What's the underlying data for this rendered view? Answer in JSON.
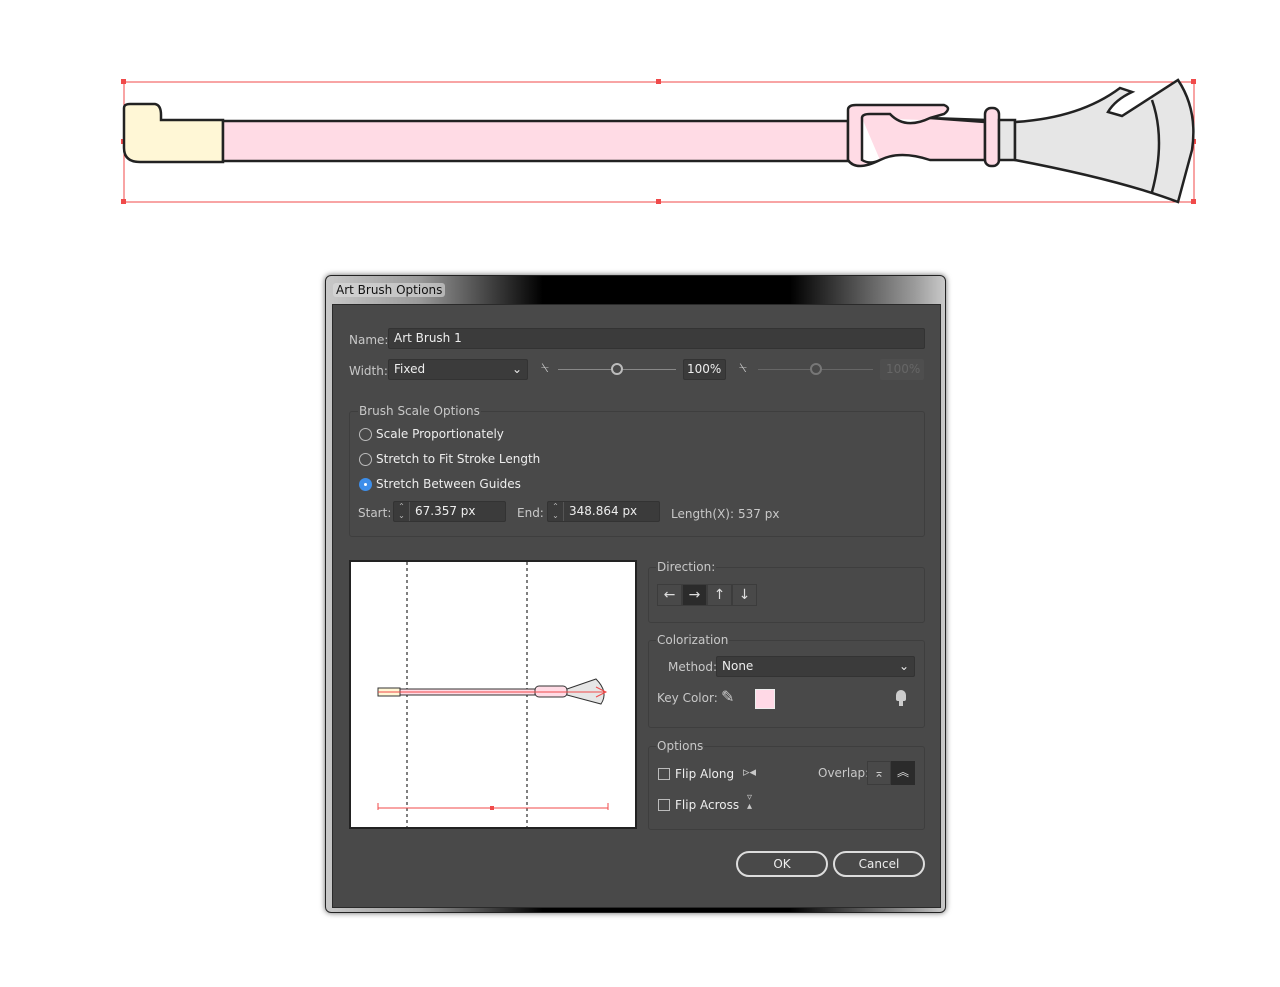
{
  "dialog": {
    "title": "Art Brush Options",
    "name_label": "Name:",
    "name_value": "Art Brush 1",
    "width_label": "Width:",
    "width_value": "Fixed",
    "width_pct": "100%",
    "width_pct2": "100%",
    "scale_group": "Brush Scale Options",
    "scale_options": [
      "Scale Proportionately",
      "Stretch to Fit Stroke Length",
      "Stretch Between Guides"
    ],
    "selected_scale": 2,
    "start_label": "Start:",
    "start_value": "67.357 px",
    "end_label": "End:",
    "end_value": "348.864 px",
    "length_label": "Length(X):",
    "length_value": "537 px",
    "direction_label": "Direction:",
    "direction_buttons": [
      "←",
      "→",
      "↑",
      "↓"
    ],
    "selected_direction": 1,
    "colorization_label": "Colorization",
    "method_label": "Method:",
    "method_value": "None",
    "key_color_label": "Key Color:",
    "key_color": "#ffd9e6",
    "options_label": "Options",
    "flip_along": "Flip Along",
    "flip_across": "Flip Across",
    "overlap_label": "Overlap:",
    "ok": "OK",
    "cancel": "Cancel"
  },
  "colors": {
    "selection": "#f04a4a",
    "shaft": "#ffdbe5",
    "handle": "#fff7d6",
    "head": "#e6e6e6",
    "accent": "#3d8eea"
  }
}
